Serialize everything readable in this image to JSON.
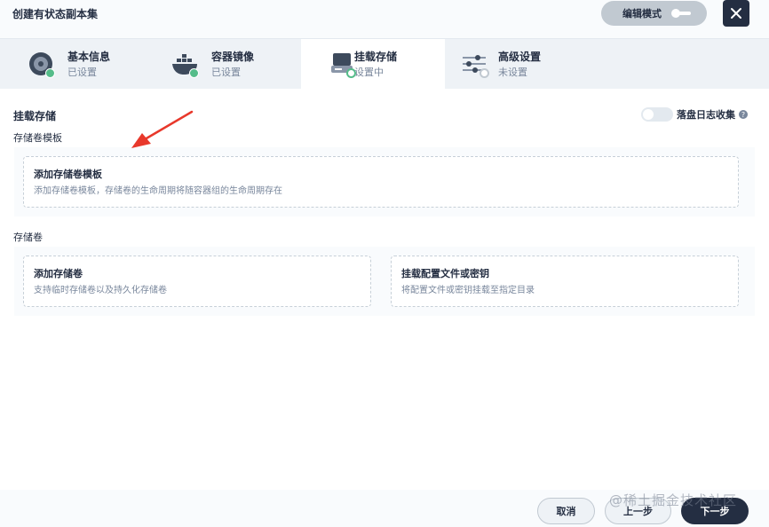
{
  "header": {
    "title": "创建有状态副本集",
    "edit_mode_label": "编辑模式"
  },
  "steps": [
    {
      "name": "基本信息",
      "status": "已设置"
    },
    {
      "name": "容器镜像",
      "status": "已设置"
    },
    {
      "name": "挂载存储",
      "status": "设置中"
    },
    {
      "name": "高级设置",
      "status": "未设置"
    }
  ],
  "content": {
    "title": "挂载存储",
    "log_toggle_label": "落盘日志收集",
    "help_glyph": "?",
    "template_section": {
      "label": "存储卷模板",
      "card": {
        "title": "添加存储卷模板",
        "desc": "添加存储卷模板，存储卷的生命周期将随容器组的生命周期存在"
      }
    },
    "volume_section": {
      "label": "存储卷",
      "cards": [
        {
          "title": "添加存储卷",
          "desc": "支持临时存储卷以及持久化存储卷"
        },
        {
          "title": "挂载配置文件或密钥",
          "desc": "将配置文件或密钥挂载至指定目录"
        }
      ]
    }
  },
  "footer": {
    "cancel_label": "取消",
    "prev_label": "上一步",
    "next_label": "下一步"
  },
  "watermark": "@稀土掘金技术社区",
  "colors": {
    "primary": "#242e42",
    "success": "#55bc8a",
    "annotation_arrow": "#e8382b"
  }
}
